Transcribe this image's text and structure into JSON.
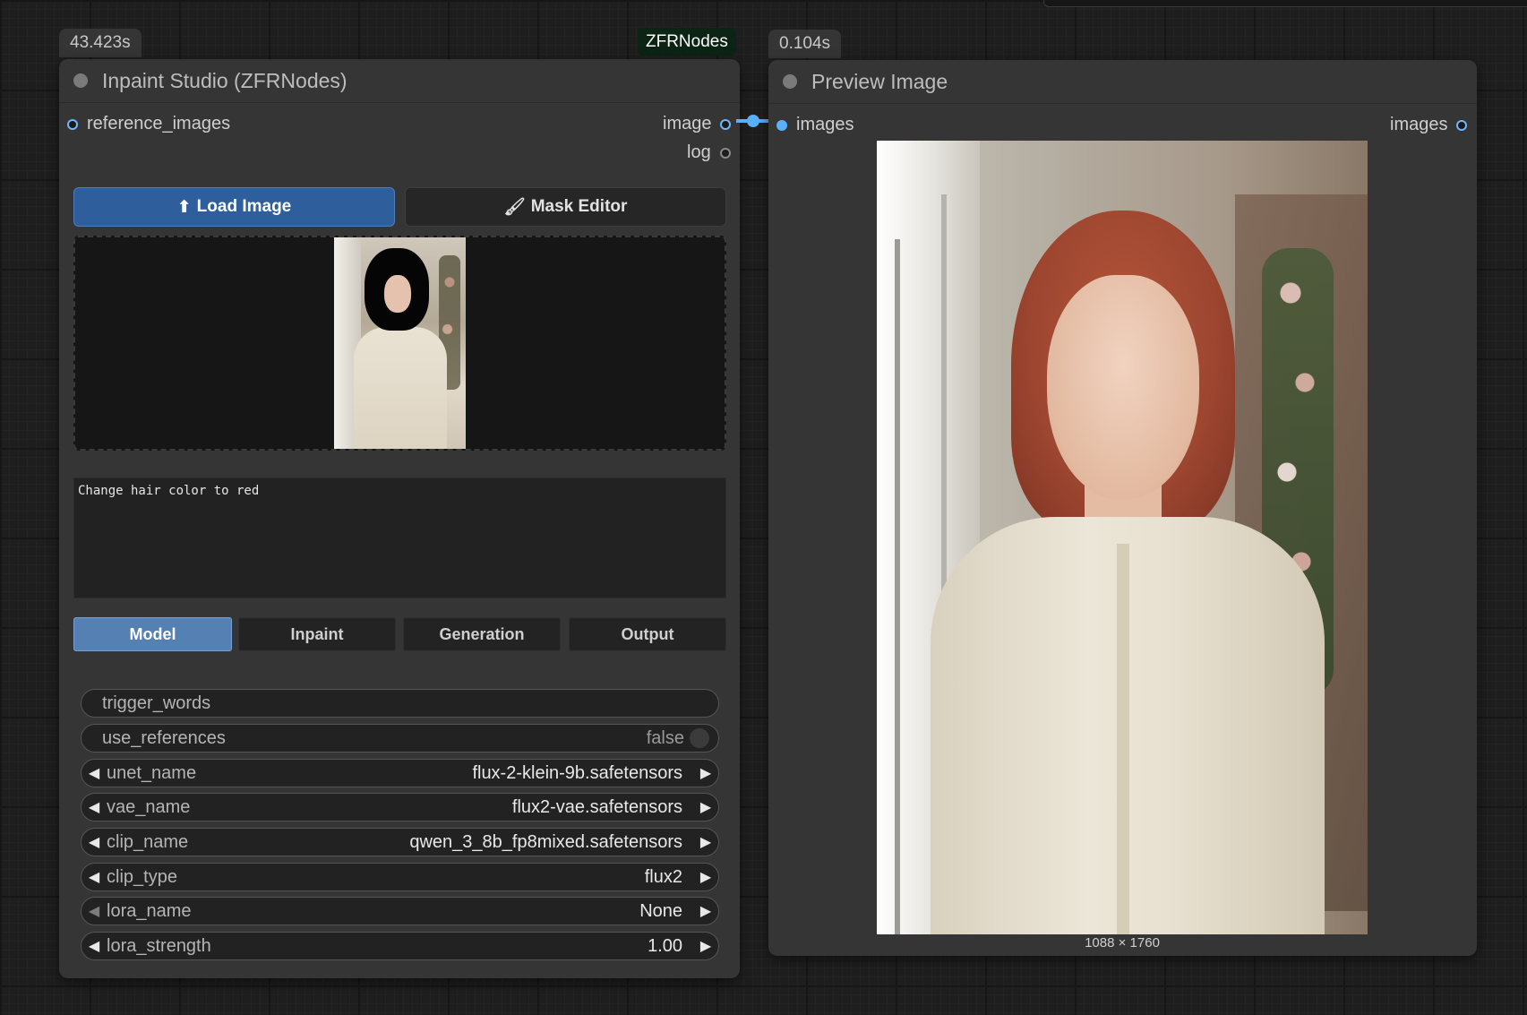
{
  "left_node": {
    "time_badge": "43.423s",
    "source_badge": "ZFRNodes",
    "title": "Inpaint Studio (ZFRNodes)",
    "inputs": [
      {
        "label": "reference_images"
      }
    ],
    "outputs": [
      {
        "label": "image"
      },
      {
        "label": "log"
      }
    ],
    "load_button": {
      "icon": "upload-arrow-icon",
      "label": "Load Image"
    },
    "mask_button": {
      "icon": "brush-icon",
      "label": "Mask Editor"
    },
    "prompt_text": "Change hair color to red",
    "tabs": [
      {
        "label": "Model",
        "active": true
      },
      {
        "label": "Inpaint",
        "active": false
      },
      {
        "label": "Generation",
        "active": false
      },
      {
        "label": "Output",
        "active": false
      }
    ],
    "widgets": {
      "trigger_words": {
        "label": "trigger_words",
        "value": ""
      },
      "use_references": {
        "label": "use_references",
        "value": "false"
      },
      "unet_name": {
        "label": "unet_name",
        "value": "flux-2-klein-9b.safetensors"
      },
      "vae_name": {
        "label": "vae_name",
        "value": "flux2-vae.safetensors"
      },
      "clip_name": {
        "label": "clip_name",
        "value": "qwen_3_8b_fp8mixed.safetensors"
      },
      "clip_type": {
        "label": "clip_type",
        "value": "flux2"
      },
      "lora_name": {
        "label": "lora_name",
        "value": "None"
      },
      "lora_strength": {
        "label": "lora_strength",
        "value": "1.00"
      }
    }
  },
  "right_node": {
    "time_badge": "0.104s",
    "title": "Preview Image",
    "input_label": "images",
    "output_label": "images",
    "image_caption": "1088 × 1760"
  },
  "colors": {
    "accent_blue": "#2e5f9c",
    "tab_active": "#5580b3",
    "link": "#5ab0ff",
    "node_bg": "#353535",
    "canvas_bg": "#1e1e1e"
  }
}
